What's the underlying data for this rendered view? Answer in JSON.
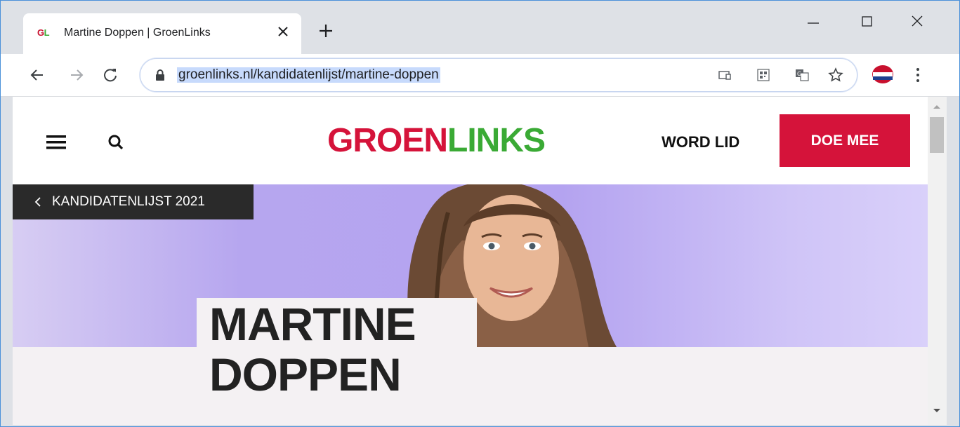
{
  "browser": {
    "tab": {
      "favicon_text_g": "G",
      "favicon_text_l": "L",
      "title": "Martine Doppen | GroenLinks"
    },
    "address": {
      "url": "groenlinks.nl/kandidatenlijst/martine-doppen"
    },
    "icons": {
      "tab_close": "close-icon",
      "new_tab": "plus-icon",
      "minimize": "minimize-icon",
      "maximize": "maximize-icon",
      "close_window": "close-icon",
      "back": "arrow-left-icon",
      "forward": "arrow-right-icon",
      "reload": "reload-icon",
      "lock": "lock-icon",
      "cast": "cast-icon",
      "qr": "qr-code-icon",
      "translate": "translate-icon",
      "bookmark": "star-icon",
      "extension": "extension-icon",
      "menu": "kebab-menu-icon"
    }
  },
  "site": {
    "logo": {
      "part1": "GROEN",
      "part2": "LINKS",
      "color1": "#d5133a",
      "color2": "#3aaa35"
    },
    "nav": {
      "word_lid": "WORD LID",
      "doe_mee": "DOE MEE",
      "accent": "#d5133a"
    },
    "back_link": "KANDIDATENLIJST 2021",
    "candidate": {
      "first": "MARTINE",
      "last": "DOPPEN"
    }
  }
}
